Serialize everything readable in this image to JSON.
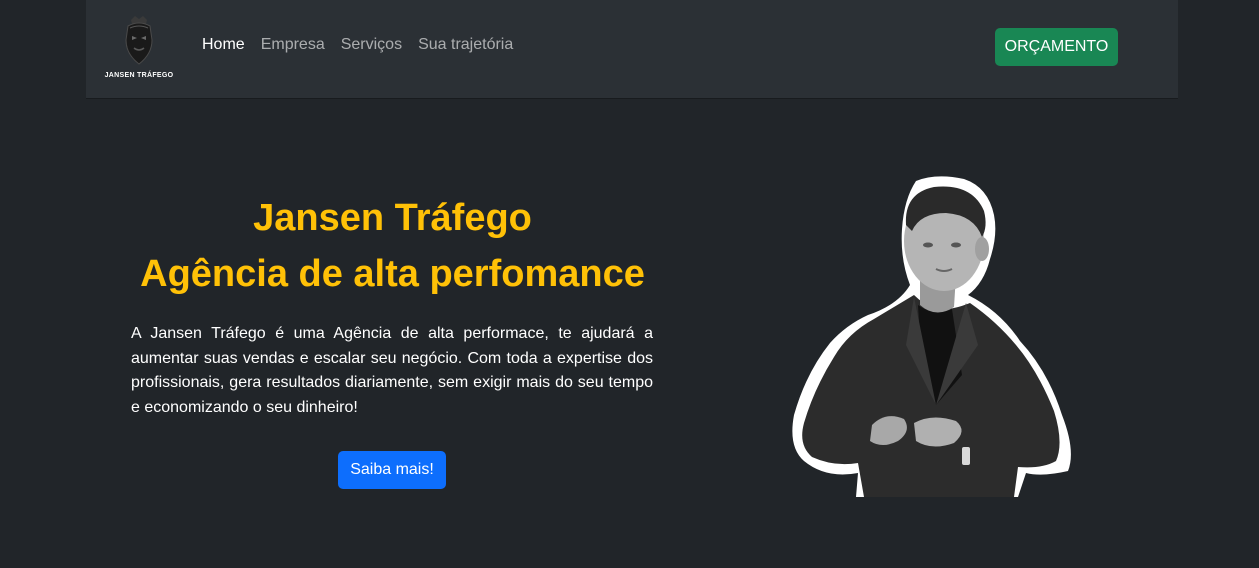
{
  "navbar": {
    "logo_text": "JANSEN TRÁFEGO",
    "links": [
      {
        "label": "Home",
        "active": true
      },
      {
        "label": "Empresa",
        "active": false
      },
      {
        "label": "Serviços",
        "active": false
      },
      {
        "label": "Sua trajetória",
        "active": false
      }
    ],
    "cta_label": "ORÇAMENTO"
  },
  "hero": {
    "title_line1": "Jansen Tráfego",
    "title_line2": "Agência de alta perfomance",
    "description": "A Jansen Tráfego é uma Agência de alta performace, te ajudará a aumentar suas vendas e escalar seu negócio. Com toda a expertise dos profissionais, gera resultados diariamente, sem exigir mais do seu tempo e economizando o seu dinheiro!",
    "button_label": "Saiba mais!"
  },
  "colors": {
    "background": "#212529",
    "navbar": "#2b3035",
    "accent_yellow": "#ffc107",
    "cta_green": "#198754",
    "button_blue": "#0d6efd"
  }
}
